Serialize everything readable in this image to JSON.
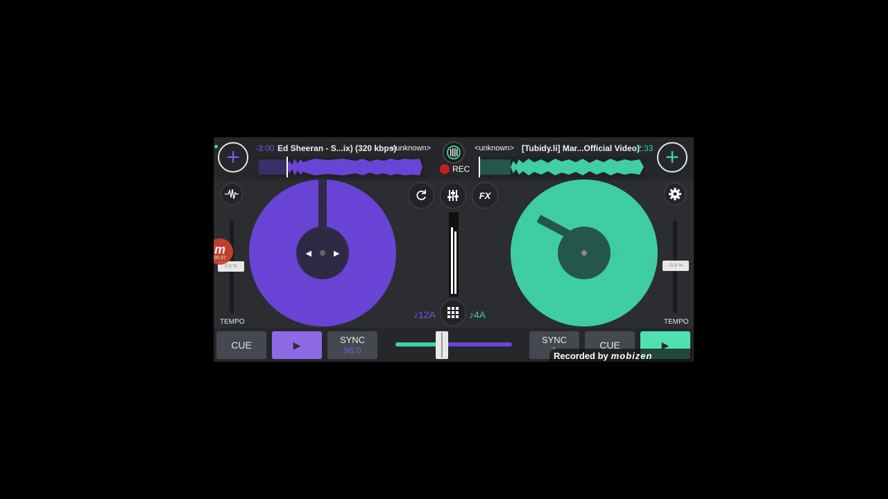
{
  "colors": {
    "deck_a": "#6a44d6",
    "deck_b": "#3fcfa3",
    "background": "#2b2d31"
  },
  "deck_a": {
    "time": "-3:00",
    "track": "Ed Sheeran - S...ix) (320 kbps)",
    "artist": "<unknown>",
    "tempo_value": "0.0 %",
    "tempo_label": "TEMPO",
    "key": "♪12A",
    "cue_label": "CUE",
    "play_icon": "play-icon",
    "sync_label": "SYNC",
    "bpm": "96.0"
  },
  "deck_b": {
    "time": "-2:33",
    "track": "[Tubidy.li] Mar...Official Video)",
    "artist": "<unknown>",
    "tempo_value": "-0.4 %",
    "tempo_label": "TEMPO",
    "key": "♪4A",
    "cue_label": "CUE",
    "sync_label": "SYNC",
    "bpm": "1"
  },
  "center": {
    "rec_label": "REC",
    "fx_label": "FX"
  },
  "overlay": {
    "mobizen_time": "00:37",
    "mobizen_letter": "m",
    "recorded_by": "Recorded by",
    "mobizen_brand": "mobizen"
  }
}
